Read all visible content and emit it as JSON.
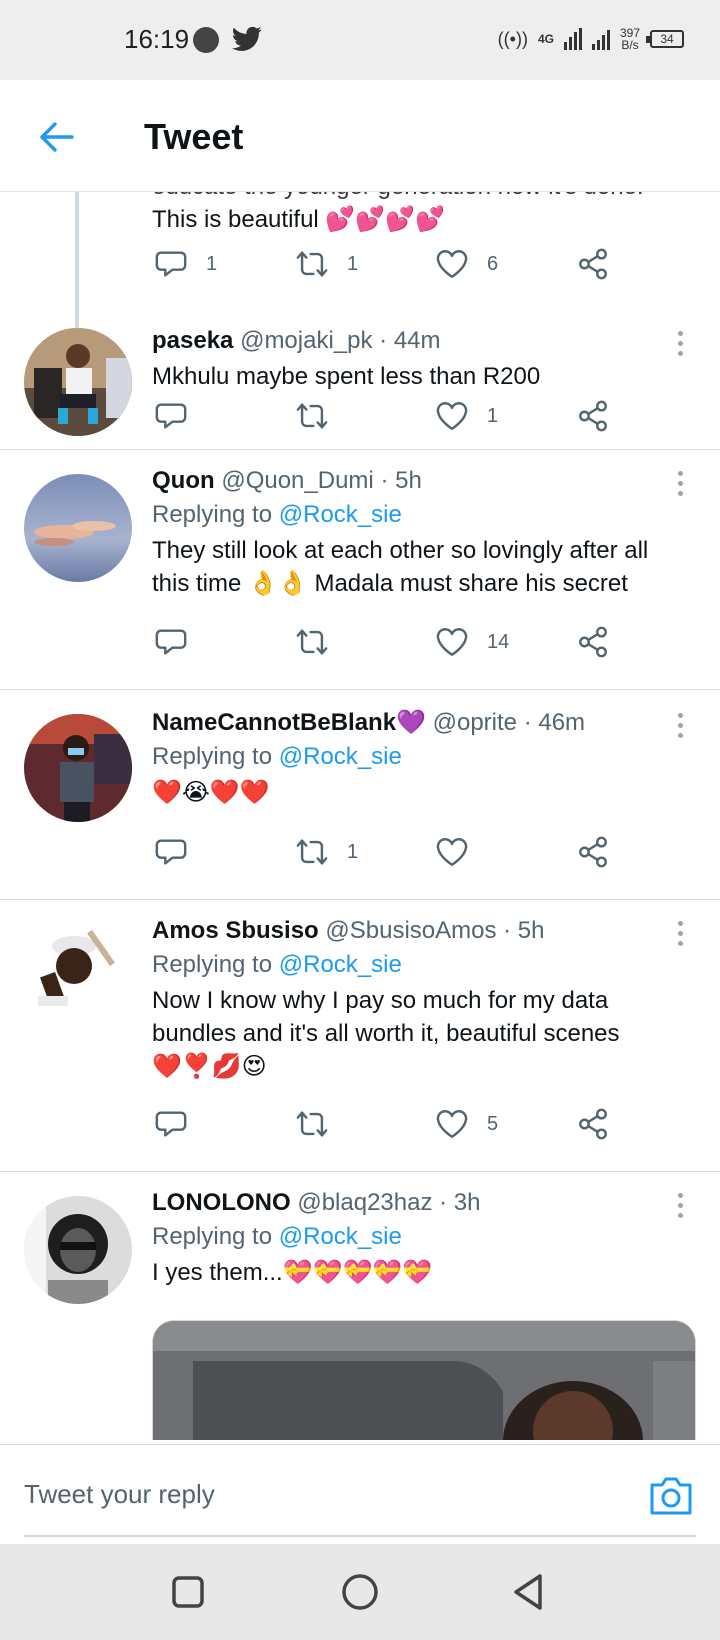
{
  "status_bar": {
    "time": "16:19",
    "network": "4G",
    "speed_value": "397",
    "speed_unit": "B/s",
    "battery": "34"
  },
  "header": {
    "back_icon": "arrow-left-icon",
    "title": "Tweet"
  },
  "top_tweet": {
    "cut_text": "educate the younger generation now it's done.",
    "text": "This is beautiful 💕💕💕💕",
    "reply_count": "1",
    "retweet_count": "1",
    "like_count": "6"
  },
  "replies": [
    {
      "name": "paseka",
      "handle": "@mojaki_pk",
      "time": "· 44m",
      "replying": "",
      "text": "Mkhulu maybe spent less than R200",
      "reply_count": "",
      "retweet_count": "",
      "like_count": "1"
    },
    {
      "name": "Quon",
      "handle": "@Quon_Dumi",
      "time": "· 5h",
      "replying_label": "Replying to",
      "replying_to": "@Rock_sie",
      "text": "They still look at each other so lovingly after all this time 👌👌 Madala must share his secret",
      "reply_count": "",
      "retweet_count": "",
      "like_count": "14"
    },
    {
      "name": "NameCannotBeBlank💜",
      "handle": "@oprite",
      "time": "· 46m",
      "replying_label": "Replying to",
      "replying_to": "@Rock_sie",
      "text": "❤️😭❤️❤️",
      "reply_count": "",
      "retweet_count": "1",
      "like_count": ""
    },
    {
      "name": "Amos Sbusiso",
      "handle": "@SbusisoAmos",
      "time": "· 5h",
      "replying_label": "Replying to",
      "replying_to": "@Rock_sie",
      "text": "Now I know why I pay so much for my data bundles and it's all worth it, beautiful scenes ❤️❣️💋😍",
      "reply_count": "",
      "retweet_count": "",
      "like_count": "5"
    },
    {
      "name": "LONOLONO",
      "handle": "@blaq23haz",
      "time": "· 3h",
      "replying_label": "Replying to",
      "replying_to": "@Rock_sie",
      "text": "I yes them...💝💝💝💝💝"
    }
  ],
  "reply_bar": {
    "placeholder": "Tweet your reply",
    "camera_icon": "camera-icon"
  },
  "nav": {
    "recents_icon": "square-icon",
    "home_icon": "circle-icon",
    "back_icon": "triangle-back-icon"
  },
  "colors": {
    "accent": "#1d9bf0",
    "text": "#0f1419",
    "secondary": "#536471"
  }
}
